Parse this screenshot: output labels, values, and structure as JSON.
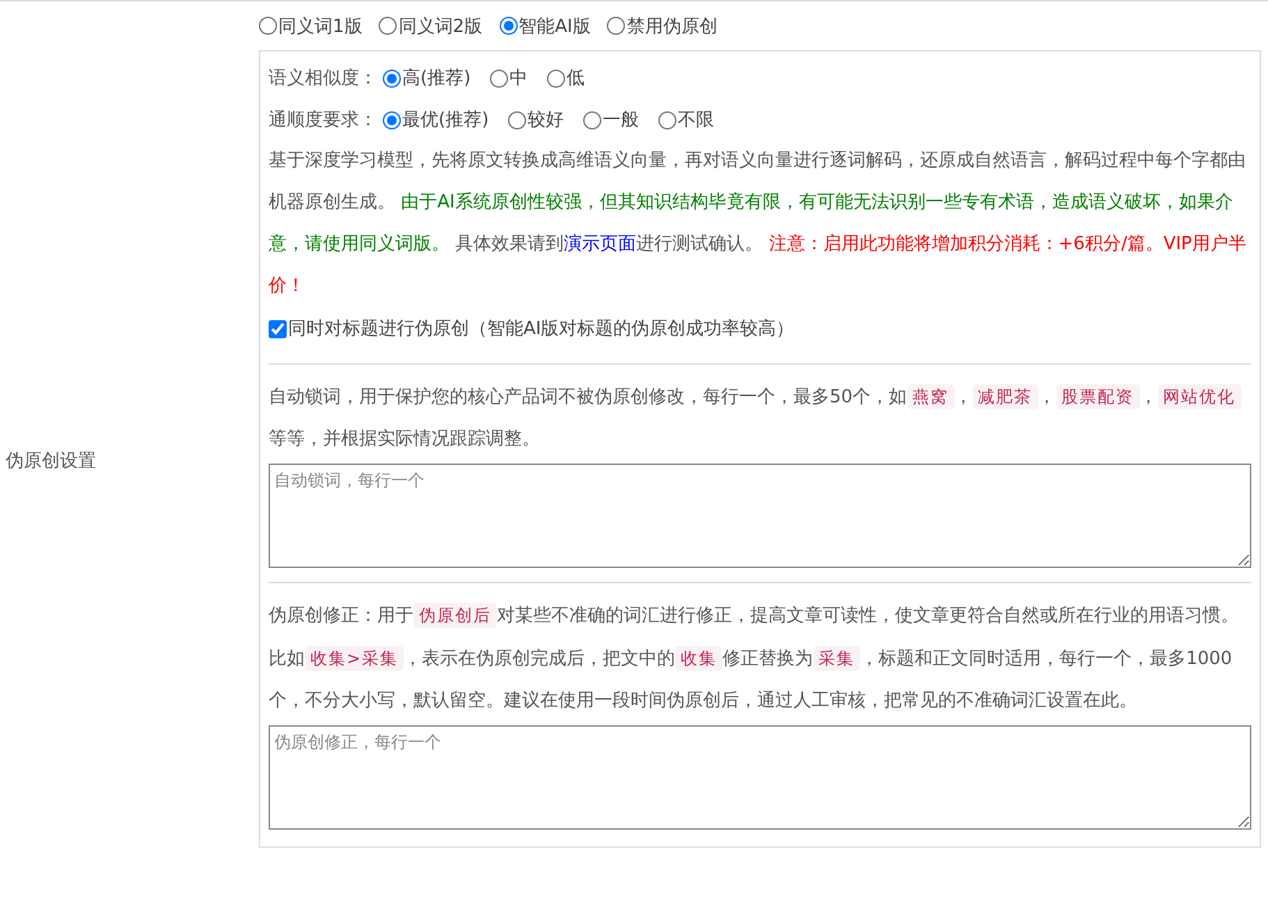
{
  "settings_label": "伪原创设置",
  "mode_options": [
    {
      "label": "同义词1版",
      "selected": false
    },
    {
      "label": "同义词2版",
      "selected": false
    },
    {
      "label": "智能AI版",
      "selected": true
    },
    {
      "label": "禁用伪原创",
      "selected": false
    }
  ],
  "similarity": {
    "label": "语义相似度：",
    "options": [
      {
        "label": "高(推荐)",
        "selected": true
      },
      {
        "label": "中",
        "selected": false
      },
      {
        "label": "低",
        "selected": false
      }
    ]
  },
  "fluency": {
    "label": "通顺度要求：",
    "options": [
      {
        "label": "最优(推荐)",
        "selected": true
      },
      {
        "label": "较好",
        "selected": false
      },
      {
        "label": "一般",
        "selected": false
      },
      {
        "label": "不限",
        "selected": false
      }
    ]
  },
  "ai_description": [
    {
      "kind": "plain",
      "text": "基于深度学习模型，先将原文转换成高维语义向量，再对语义向量进行逐词解码，还原成自然语言，解码过程中每个字都由机器原创生成。 "
    },
    {
      "kind": "green",
      "text": "由于AI系统原创性较强，但其知识结构毕竟有限，有可能无法识别一些专有术语，造成语义破坏，如果介意，请使用同义词版。"
    },
    {
      "kind": "plain",
      "text": " 具体效果请到"
    },
    {
      "kind": "link",
      "text": "演示页面"
    },
    {
      "kind": "plain",
      "text": "进行测试确认。 "
    },
    {
      "kind": "red",
      "text": "注意：启用此功能将增加积分消耗：+6积分/篇。VIP用户半价！"
    }
  ],
  "title_checkbox": {
    "label": "同时对标题进行伪原创（智能AI版对标题的伪原创成功率较高）",
    "checked": true
  },
  "lock_words": {
    "description": [
      {
        "kind": "plain",
        "text": "自动锁词，用于保护您的核心产品词不被伪原创修改，每行一个，最多50个，如"
      },
      {
        "kind": "tag",
        "text": "燕窝"
      },
      {
        "kind": "plain",
        "text": "，"
      },
      {
        "kind": "tag",
        "text": "减肥茶"
      },
      {
        "kind": "plain",
        "text": "，"
      },
      {
        "kind": "tag",
        "text": "股票配资"
      },
      {
        "kind": "plain",
        "text": "，"
      },
      {
        "kind": "tag",
        "text": "网站优化"
      },
      {
        "kind": "plain",
        "text": "等等，并根据实际情况跟踪调整。"
      }
    ],
    "placeholder": "自动锁词，每行一个"
  },
  "correction": {
    "description": [
      {
        "kind": "plain",
        "text": "伪原创修正：用于"
      },
      {
        "kind": "tag",
        "text": "伪原创后"
      },
      {
        "kind": "plain",
        "text": "对某些不准确的词汇进行修正，提高文章可读性，使文章更符合自然或所在行业的用语习惯。比如"
      },
      {
        "kind": "tag",
        "text": "收集>采集"
      },
      {
        "kind": "plain",
        "text": "，表示在伪原创完成后，把文中的"
      },
      {
        "kind": "tag",
        "text": "收集"
      },
      {
        "kind": "plain",
        "text": "修正替换为"
      },
      {
        "kind": "tag",
        "text": "采集"
      },
      {
        "kind": "plain",
        "text": "，标题和正文同时适用，每行一个，最多1000个，不分大小写，默认留空。建议在使用一段时间伪原创后，通过人工审核，把常见的不准确词汇设置在此。"
      }
    ],
    "placeholder": "伪原创修正，每行一个"
  }
}
